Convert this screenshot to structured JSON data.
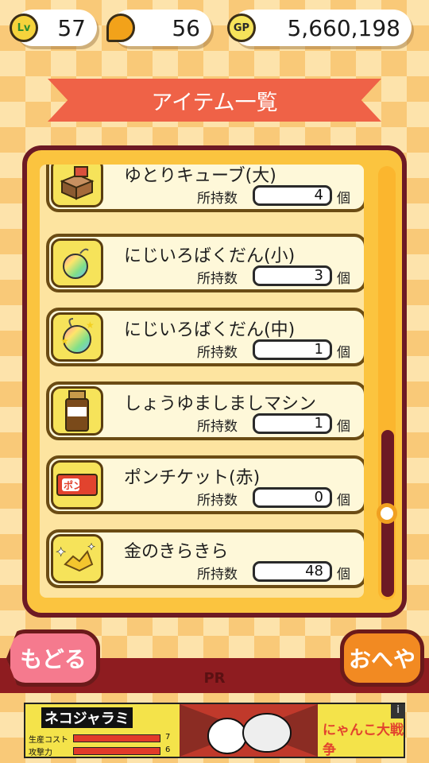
{
  "status": {
    "level_badge": "Lv",
    "level": "57",
    "catfood": "56",
    "gp_badge": "GP",
    "gp": "5,660,198"
  },
  "title": "アイテム一覧",
  "items": [
    {
      "name": "ゆとりキューブ(大)",
      "count_label": "所持数",
      "count": "4",
      "unit": "個",
      "icon": "cube-box-icon"
    },
    {
      "name": "にじいろばくだん(小)",
      "count_label": "所持数",
      "count": "3",
      "unit": "個",
      "icon": "rainbow-bomb-icon"
    },
    {
      "name": "にじいろばくだん(中)",
      "count_label": "所持数",
      "count": "1",
      "unit": "個",
      "icon": "rainbow-bomb-star-icon"
    },
    {
      "name": "しょうゆましましマシン",
      "count_label": "所持数",
      "count": "1",
      "unit": "個",
      "icon": "soy-sauce-icon"
    },
    {
      "name": "ポンチケット(赤)",
      "count_label": "所持数",
      "count": "0",
      "unit": "個",
      "icon": "pon-ticket-icon"
    },
    {
      "name": "金のきらきら",
      "count_label": "所持数",
      "count": "48",
      "unit": "個",
      "icon": "gold-sparkle-icon"
    }
  ],
  "scroll": {
    "position": 0.92
  },
  "buttons": {
    "back": "もどる",
    "home": "おへや"
  },
  "pr": "PR",
  "ad": {
    "brand": "ネコジャラミ",
    "stat1_label": "生産コスト",
    "stat1": "7",
    "stat2_label": "攻撃力",
    "stat2": "6",
    "game": "にゃんこ大戦争",
    "info": "i"
  },
  "colors": {
    "accent": "#ef6247",
    "panel": "#fbc43f",
    "border": "#6d1a24"
  }
}
